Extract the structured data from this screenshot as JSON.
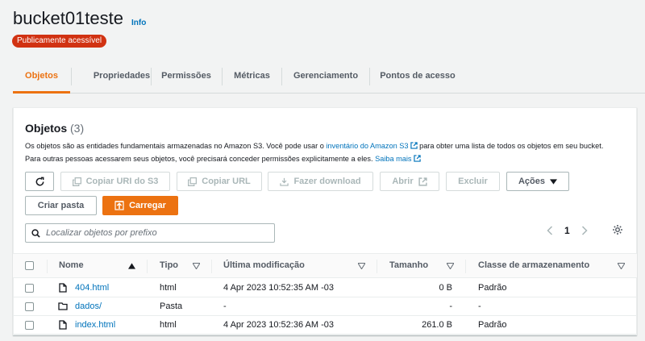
{
  "header": {
    "title": "bucket01teste",
    "info_link": "Info",
    "badge": "Publicamente acessível"
  },
  "tabs": [
    {
      "label": "Objetos",
      "active": true
    },
    {
      "label": "Propriedades"
    },
    {
      "label": "Permissões"
    },
    {
      "label": "Métricas"
    },
    {
      "label": "Gerenciamento"
    },
    {
      "label": "Pontos de acesso"
    }
  ],
  "objects": {
    "title": "Objetos",
    "count": "(3)",
    "desc1_pre": "Os objetos são as entidades fundamentais armazenadas no Amazon S3. Você pode usar o ",
    "desc1_link": "inventário do Amazon S3",
    "desc1_post": "para obter uma lista de todos os objetos em seu bucket.",
    "desc2_pre": "Para outras pessoas acessarem seus objetos, você precisará conceder permissões explicitamente a eles. ",
    "desc2_link": "Saiba mais"
  },
  "toolbar": {
    "copy_uri": "Copiar URI do S3",
    "copy_url": "Copiar URL",
    "download": "Fazer download",
    "open": "Abrir",
    "delete": "Excluir",
    "actions": "Ações",
    "create_folder": "Criar pasta",
    "upload": "Carregar"
  },
  "search": {
    "placeholder": "Localizar objetos por prefixo"
  },
  "pagination": {
    "page": "1"
  },
  "table": {
    "columns": [
      "Nome",
      "Tipo",
      "Última modificação",
      "Tamanho",
      "Classe de armazenamento"
    ],
    "rows": [
      {
        "name": "404.html",
        "icon": "file-icon",
        "type": "html",
        "modified": "4 Apr 2023 10:52:35 AM -03",
        "size": "0 B",
        "class": "Padrão"
      },
      {
        "name": "dados/",
        "icon": "folder-icon",
        "type": "Pasta",
        "modified": "-",
        "size": "-",
        "class": "-"
      },
      {
        "name": "index.html",
        "icon": "file-icon",
        "type": "html",
        "modified": "4 Apr 2023 10:52:36 AM -03",
        "size": "261.0 B",
        "class": "Padrão"
      }
    ]
  },
  "colors": {
    "accent": "#ec7211",
    "link": "#0073bb",
    "badge": "#d13212"
  }
}
